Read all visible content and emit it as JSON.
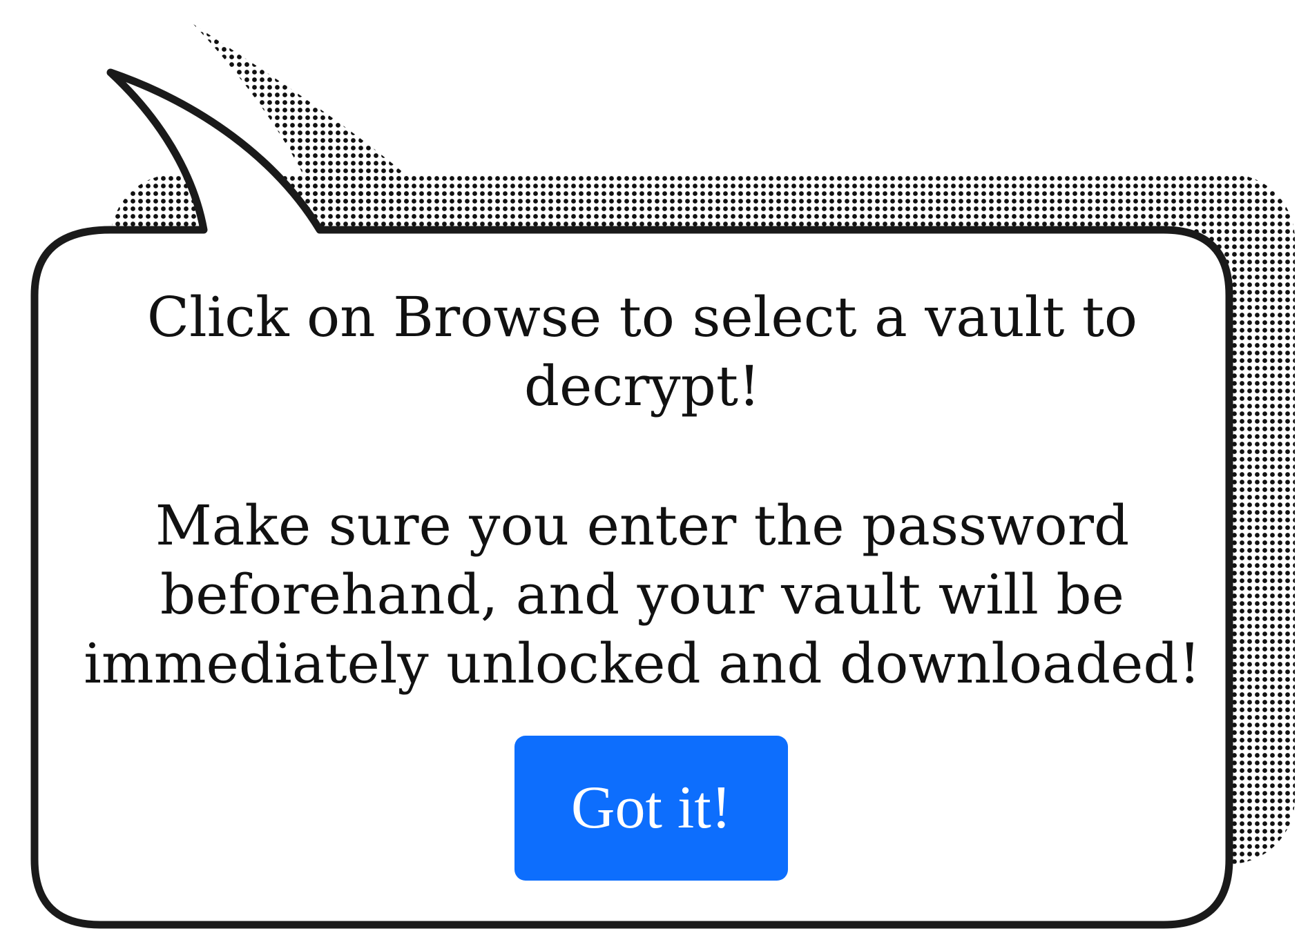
{
  "dialog": {
    "instruction_line": "Click on Browse to select a vault to decrypt!",
    "detail_line": "Make sure you enter the password beforehand, and your vault will be immediately unlocked and downloaded!",
    "confirm_label": "Got it!"
  },
  "colors": {
    "button_background": "#0d6efd",
    "button_text": "#ffffff",
    "bubble_outline": "#1a1a1a",
    "bubble_fill": "#ffffff",
    "halftone_dot": "#111111"
  },
  "icons": {
    "bubble": "speech-bubble-icon"
  }
}
